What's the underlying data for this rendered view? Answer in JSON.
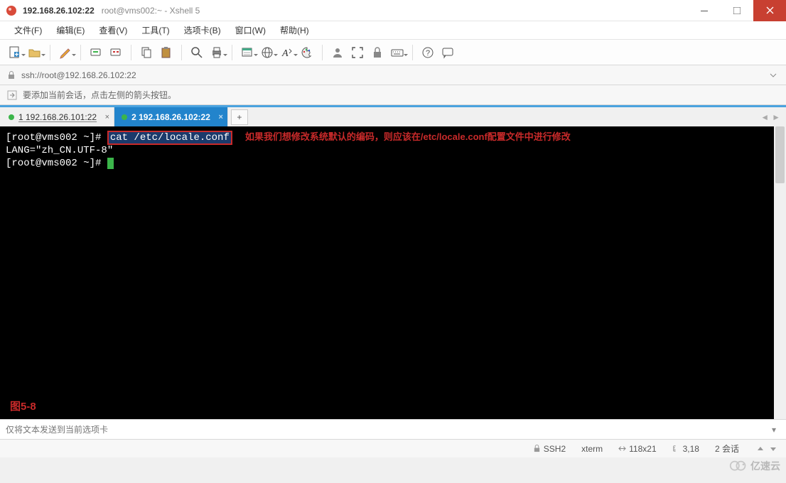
{
  "window": {
    "title_main": "192.168.26.102:22",
    "title_sub": "root@vms002:~ - Xshell 5"
  },
  "menu": {
    "file": "文件(F)",
    "edit": "编辑(E)",
    "view": "查看(V)",
    "tools": "工具(T)",
    "tab": "选项卡(B)",
    "window": "窗口(W)",
    "help": "帮助(H)"
  },
  "address": {
    "url": "ssh://root@192.168.26.102:22"
  },
  "hint": {
    "text": "要添加当前会话，点击左侧的箭头按钮。"
  },
  "tabs": {
    "tab1": {
      "label": "1 192.168.26.101:22"
    },
    "tab2": {
      "label": "2 192.168.26.102:22"
    },
    "add": "+"
  },
  "terminal": {
    "prompt1": "[root@vms002 ~]# ",
    "command": "cat /etc/locale.conf",
    "annotation": "如果我们想修改系统默认的编码，则应该在/etc/locale.conf配置文件中进行修改",
    "output1": "LANG=\"zh_CN.UTF-8\"",
    "prompt2": "[root@vms002 ~]# ",
    "figure_label": "图5-8"
  },
  "sendbar": {
    "placeholder": "仅将文本发送到当前选项卡"
  },
  "status": {
    "protocol": "SSH2",
    "term": "xterm",
    "size": "118x21",
    "pos": "3,18",
    "sessions": "2 会话"
  },
  "watermark": {
    "text": "亿速云"
  },
  "icons": {
    "new_doc": "new-doc-icon",
    "open": "open-folder-icon",
    "pencil": "pencil-icon",
    "reconnect": "reconnect-icon",
    "disconnect": "disconnect-icon",
    "copy": "copy-icon",
    "paste": "paste-icon",
    "search": "search-icon",
    "print": "print-icon",
    "props": "properties-icon",
    "globe": "globe-icon",
    "font": "font-icon",
    "palette": "palette-icon",
    "user": "user-icon",
    "fullscreen": "fullscreen-icon",
    "lock": "lock-icon",
    "keyboard": "keyboard-icon",
    "help": "help-icon",
    "chat": "chat-icon"
  }
}
